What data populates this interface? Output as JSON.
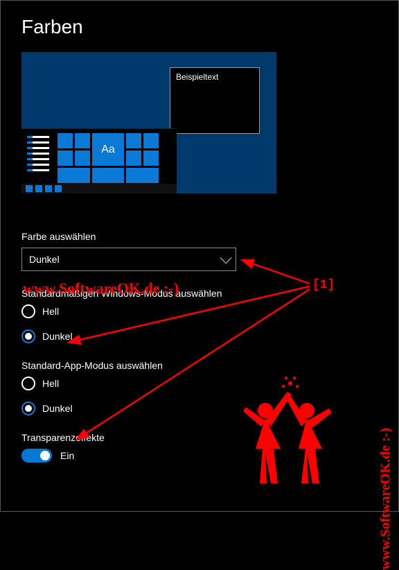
{
  "page": {
    "title": "Farben"
  },
  "preview": {
    "sample_text": "Beispieltext",
    "tile_label": "Aa"
  },
  "color_select": {
    "label": "Farbe auswählen",
    "value": "Dunkel"
  },
  "windows_mode": {
    "label": "Standardmäßigen Windows-Modus auswählen",
    "option_light": "Hell",
    "option_dark": "Dunkel",
    "selected": "dark"
  },
  "app_mode": {
    "label": "Standard-App-Modus auswählen",
    "option_light": "Hell",
    "option_dark": "Dunkel",
    "selected": "dark"
  },
  "transparency": {
    "label": "Transparenzeffekte",
    "state_text": "Ein",
    "on": true
  },
  "annotations": {
    "watermark": "www.SoftwareOK.de :-)",
    "marker": "[1]"
  }
}
